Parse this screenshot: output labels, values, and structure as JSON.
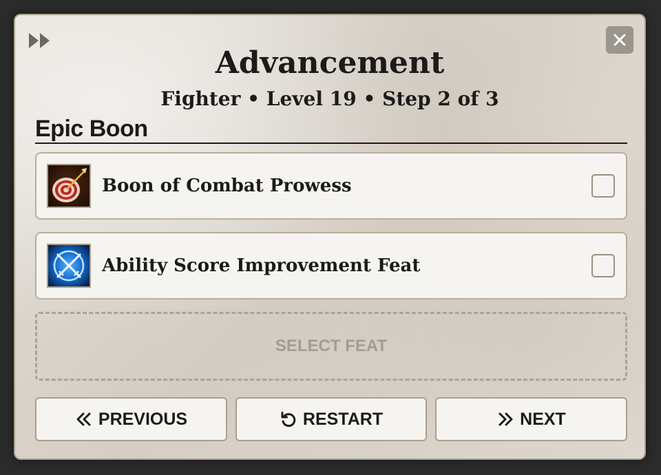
{
  "header": {
    "title": "Advancement",
    "subtitle": "Fighter • Level 19 • Step 2 of 3",
    "fast_forward_icon": "fast-forward-icon",
    "close_icon": "close-icon"
  },
  "section": {
    "title": "Epic Boon"
  },
  "options": [
    {
      "label": "Boon of Combat Prowess",
      "icon": "target-arrow-icon",
      "checked": false
    },
    {
      "label": "Ability Score Improvement Feat",
      "icon": "crossed-swords-icon",
      "checked": false
    }
  ],
  "select_feat": {
    "label": "SELECT FEAT"
  },
  "buttons": {
    "previous": {
      "label": "PREVIOUS",
      "icon": "chevrons-left-icon"
    },
    "restart": {
      "label": "RESTART",
      "icon": "rotate-ccw-icon"
    },
    "next": {
      "label": "NEXT",
      "icon": "chevrons-right-icon"
    }
  },
  "colors": {
    "panel": "#e1dcd4",
    "card": "#f6f4f1",
    "border": "#b8ae9b",
    "text": "#1c1b1a"
  }
}
